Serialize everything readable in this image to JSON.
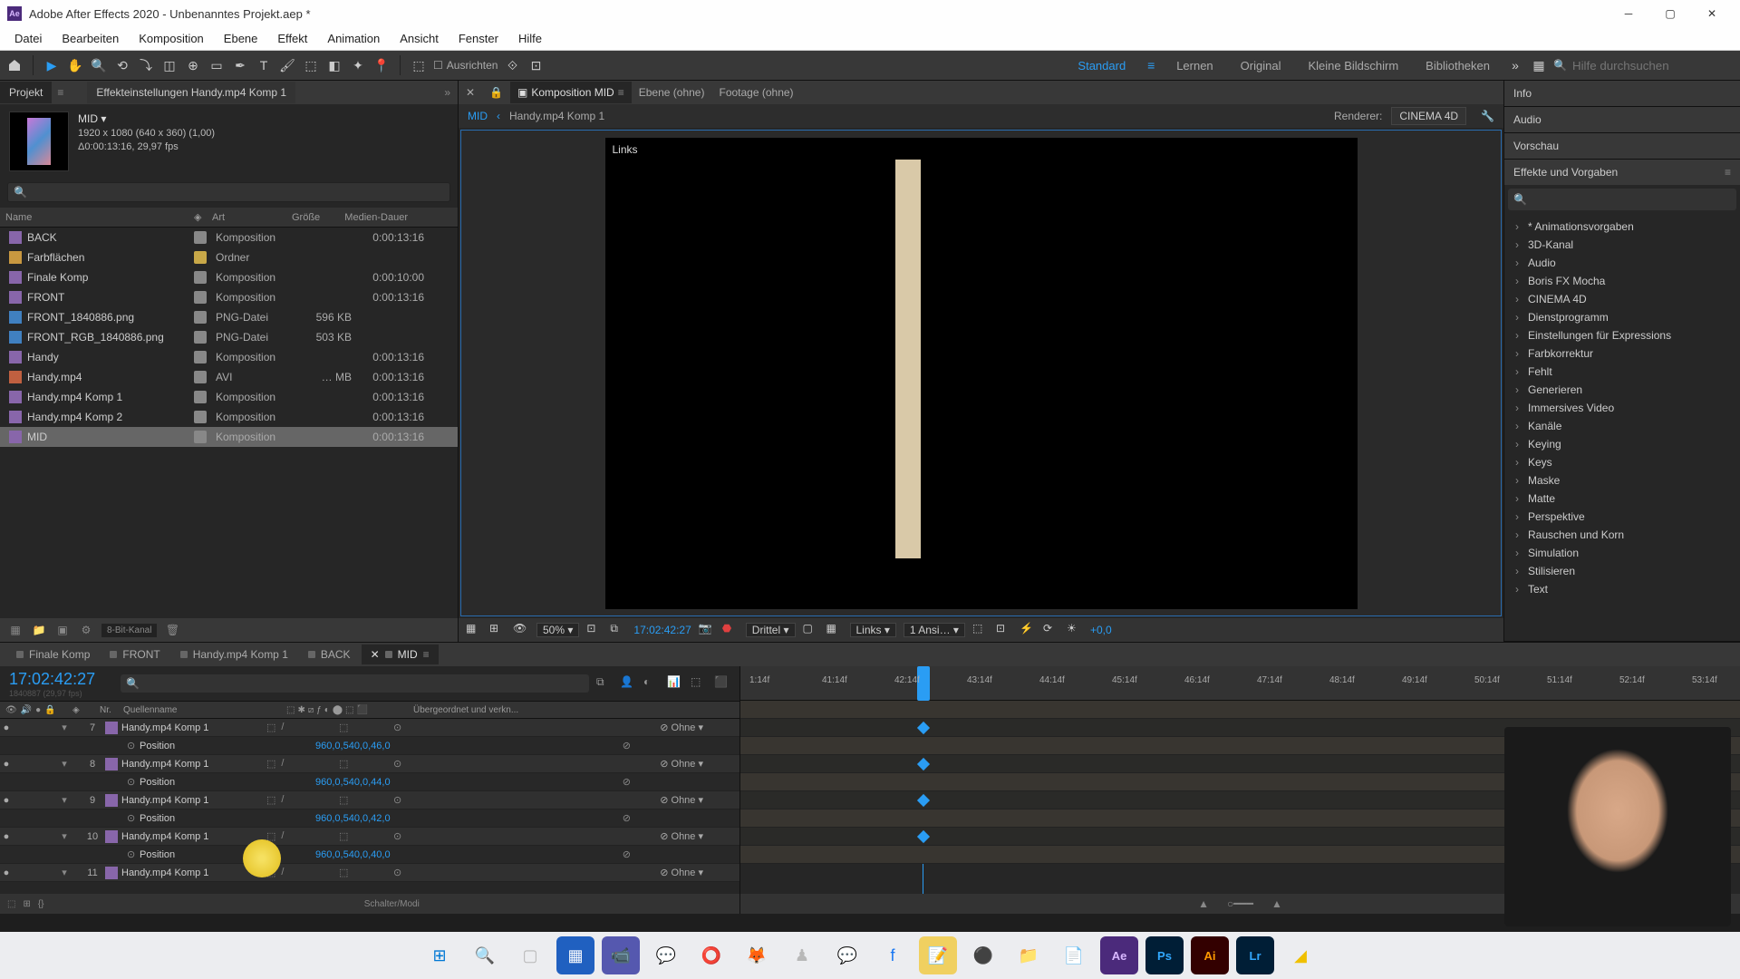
{
  "title": "Adobe After Effects 2020 - Unbenanntes Projekt.aep *",
  "menu": [
    "Datei",
    "Bearbeiten",
    "Komposition",
    "Ebene",
    "Effekt",
    "Animation",
    "Ansicht",
    "Fenster",
    "Hilfe"
  ],
  "toolbar": {
    "ausrichten": "Ausrichten",
    "ws_active": "Standard",
    "ws": [
      "Lernen",
      "Original",
      "Kleine Bildschirm",
      "Bibliotheken"
    ],
    "search_ph": "Hilfe durchsuchen"
  },
  "project": {
    "tab": "Projekt",
    "effect_tab": "Effekteinstellungen Handy.mp4 Komp 1",
    "name": "MID",
    "meta1": "1920 x 1080 (640 x 360) (1,00)",
    "meta2": "Δ0:00:13:16, 29,97 fps",
    "cols": {
      "name": "Name",
      "art": "Art",
      "size": "Größe",
      "dur": "Medien-Dauer"
    },
    "rows": [
      {
        "n": "BACK",
        "art": "Komposition",
        "s": "",
        "d": "0:00:13:16"
      },
      {
        "n": "Farbflächen",
        "art": "Ordner",
        "s": "",
        "d": "",
        "folder": true
      },
      {
        "n": "Finale Komp",
        "art": "Komposition",
        "s": "",
        "d": "0:00:10:00"
      },
      {
        "n": "FRONT",
        "art": "Komposition",
        "s": "",
        "d": "0:00:13:16"
      },
      {
        "n": "FRONT_1840886.png",
        "art": "PNG-Datei",
        "s": "596 KB",
        "d": "",
        "png": true
      },
      {
        "n": "FRONT_RGB_1840886.png",
        "art": "PNG-Datei",
        "s": "503 KB",
        "d": "",
        "png": true
      },
      {
        "n": "Handy",
        "art": "Komposition",
        "s": "",
        "d": "0:00:13:16"
      },
      {
        "n": "Handy.mp4",
        "art": "AVI",
        "s": "… MB",
        "d": "0:00:13:16",
        "avi": true
      },
      {
        "n": "Handy.mp4 Komp 1",
        "art": "Komposition",
        "s": "",
        "d": "0:00:13:16"
      },
      {
        "n": "Handy.mp4 Komp 2",
        "art": "Komposition",
        "s": "",
        "d": "0:00:13:16"
      },
      {
        "n": "MID",
        "art": "Komposition",
        "s": "",
        "d": "0:00:13:16",
        "sel": true
      }
    ],
    "foot": "8-Bit-Kanal"
  },
  "comp": {
    "tabs": [
      {
        "l": "Komposition MID",
        "a": true
      },
      {
        "l": "Ebene (ohne)"
      },
      {
        "l": "Footage (ohne)"
      }
    ],
    "bread": {
      "a": "MID",
      "b": "Handy.mp4 Komp 1",
      "renderer_label": "Renderer:",
      "renderer": "CINEMA 4D"
    },
    "view_label": "Links",
    "foot": {
      "zoom": "50%",
      "tc": "17:02:42:27",
      "res": "Drittel",
      "view": "Links",
      "views": "1 Ansi…",
      "exp": "+0,0"
    }
  },
  "right": {
    "info": "Info",
    "audio": "Audio",
    "vorschau": "Vorschau",
    "eff": "Effekte und Vorgaben",
    "cats": [
      "* Animationsvorgaben",
      "3D-Kanal",
      "Audio",
      "Boris FX Mocha",
      "CINEMA 4D",
      "Dienstprogramm",
      "Einstellungen für Expressions",
      "Farbkorrektur",
      "Fehlt",
      "Generieren",
      "Immersives Video",
      "Kanäle",
      "Keying",
      "Keys",
      "Maske",
      "Matte",
      "Perspektive",
      "Rauschen und Korn",
      "Simulation",
      "Stilisieren",
      "Text"
    ]
  },
  "timeline": {
    "tabs": [
      {
        "l": "Finale Komp"
      },
      {
        "l": "FRONT"
      },
      {
        "l": "Handy.mp4 Komp 1"
      },
      {
        "l": "BACK"
      },
      {
        "l": "MID",
        "a": true
      }
    ],
    "tc": "17:02:42:27",
    "frame": "1840887 (29,97 fps)",
    "col": {
      "nr": "Nr.",
      "name": "Quellenname",
      "parent": "Übergeordnet und verkn..."
    },
    "layers": [
      {
        "n": 7,
        "name": "Handy.mp4 Komp 1",
        "parent": "Ohne",
        "pos": "960,0,540,0,46,0"
      },
      {
        "n": 8,
        "name": "Handy.mp4 Komp 1",
        "parent": "Ohne",
        "pos": "960,0,540,0,44,0"
      },
      {
        "n": 9,
        "name": "Handy.mp4 Komp 1",
        "parent": "Ohne",
        "pos": "960,0,540,0,42,0"
      },
      {
        "n": 10,
        "name": "Handy.mp4 Komp 1",
        "parent": "Ohne",
        "pos": "960,0,540,0,40,0"
      },
      {
        "n": 11,
        "name": "Handy.mp4 Komp 1",
        "parent": "Ohne",
        "pos": ""
      }
    ],
    "pos_label": "Position",
    "ticks": [
      "1:14f",
      "41:14f",
      "42:14f",
      "43:14f",
      "44:14f",
      "45:14f",
      "46:14f",
      "47:14f",
      "48:14f",
      "49:14f",
      "50:14f",
      "51:14f",
      "52:14f",
      "53:14f"
    ],
    "foot": "Schalter/Modi"
  }
}
